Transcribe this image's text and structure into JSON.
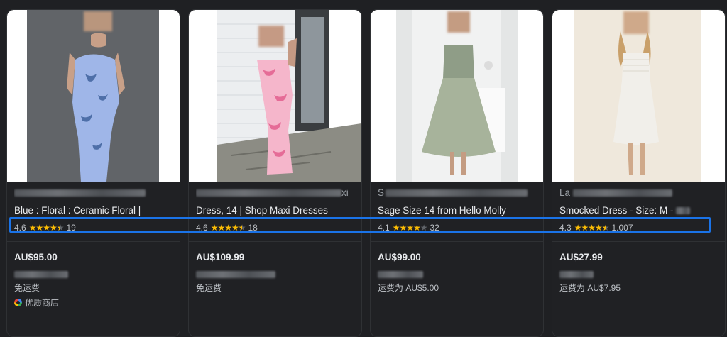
{
  "products": [
    {
      "title_line1": "",
      "title_line2": "Blue : Floral : Ceramic Floral |",
      "rating": "4.6",
      "stars_filled": 4.5,
      "reviews": "19",
      "price": "AU$95.00",
      "shipping": "免运费",
      "store_badge": "优质商店",
      "colors": {
        "bg": "#5a5d61",
        "dress": "#9fb6e8"
      }
    },
    {
      "title_line1": "xi",
      "title_line2": "Dress, 14 | Shop Maxi Dresses",
      "rating": "4.6",
      "stars_filled": 4.5,
      "reviews": "18",
      "price": "AU$109.99",
      "shipping": "免运费",
      "store_badge": "",
      "colors": {
        "bg": "#e9ebee",
        "dress": "#f4a9c4"
      }
    },
    {
      "title_line1": "S",
      "title_line2": "Sage Size 14 from Hello Molly",
      "rating": "4.1",
      "stars_filled": 4,
      "reviews": "32",
      "price": "AU$99.00",
      "shipping": "运费为 AU$5.00",
      "store_badge": "",
      "colors": {
        "bg": "#eef0f0",
        "dress": "#9aa78f"
      }
    },
    {
      "title_line1": "La",
      "title_line2": "Smocked Dress - Size: M -",
      "rating": "4.3",
      "stars_filled": 4.5,
      "reviews": "1,007",
      "price": "AU$27.99",
      "shipping": "运费为 AU$7.95",
      "store_badge": "",
      "colors": {
        "bg": "#efe9df",
        "dress": "#f0eee8"
      }
    }
  ],
  "highlight_color": "#1a73e8"
}
